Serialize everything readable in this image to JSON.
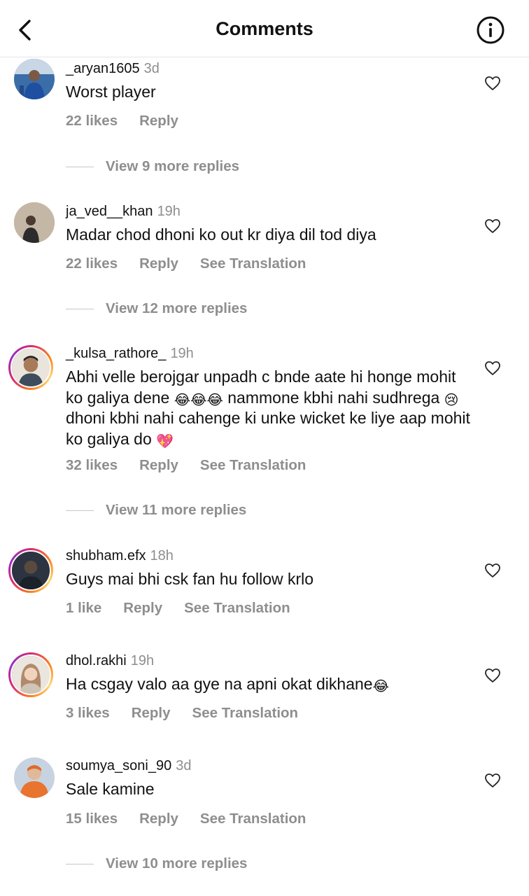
{
  "header": {
    "title": "Comments"
  },
  "comments": [
    {
      "username": "_aryan1605",
      "time": "3d",
      "text": "Worst player",
      "likes": "22 likes",
      "reply": "Reply",
      "translation": "",
      "view_more": "View 9 more replies",
      "has_story_ring": false
    },
    {
      "username": "ja_ved__khan",
      "time": "19h",
      "text": "Madar chod dhoni ko out kr diya dil tod diya",
      "likes": "22 likes",
      "reply": "Reply",
      "translation": "See Translation",
      "view_more": "View 12 more replies",
      "has_story_ring": false
    },
    {
      "username": "_kulsa_rathore_",
      "time": "19h",
      "text_parts": [
        "Abhi velle berojgar unpadh c  bnde aate hi honge mohit ko galiya dene ",
        " nammone kbhi nahi sudhrega ",
        " dhoni kbhi nahi cahenge ki unke wicket ke liye aap mohit ko galiya do "
      ],
      "emojis": {
        "laugh": "😂",
        "cry": "😢",
        "heart": "💖"
      },
      "likes": "32 likes",
      "reply": "Reply",
      "translation": "See Translation",
      "view_more": "View 11 more replies",
      "has_story_ring": true
    },
    {
      "username": "shubham.efx",
      "time": "18h",
      "text": "Guys mai bhi csk fan hu follow krlo",
      "likes": "1 like",
      "reply": "Reply",
      "translation": "See Translation",
      "view_more": "",
      "has_story_ring": true
    },
    {
      "username": "dhol.rakhi",
      "time": "19h",
      "text": "Ha csgay valo aa gye na apni okat dikhane",
      "emoji_end": "😂",
      "likes": "3 likes",
      "reply": "Reply",
      "translation": "See Translation",
      "view_more": "",
      "has_story_ring": true
    },
    {
      "username": "soumya_soni_90",
      "time": "3d",
      "text": "Sale kamine",
      "likes": "15 likes",
      "reply": "Reply",
      "translation": "See Translation",
      "view_more": "View 10 more replies",
      "has_story_ring": false
    }
  ],
  "icons": {
    "back": "chevron-left-icon",
    "info": "info-icon",
    "like": "heart-icon"
  },
  "colors": {
    "secondary_text": "#8e8e8e",
    "story_ring": "#d62976"
  }
}
